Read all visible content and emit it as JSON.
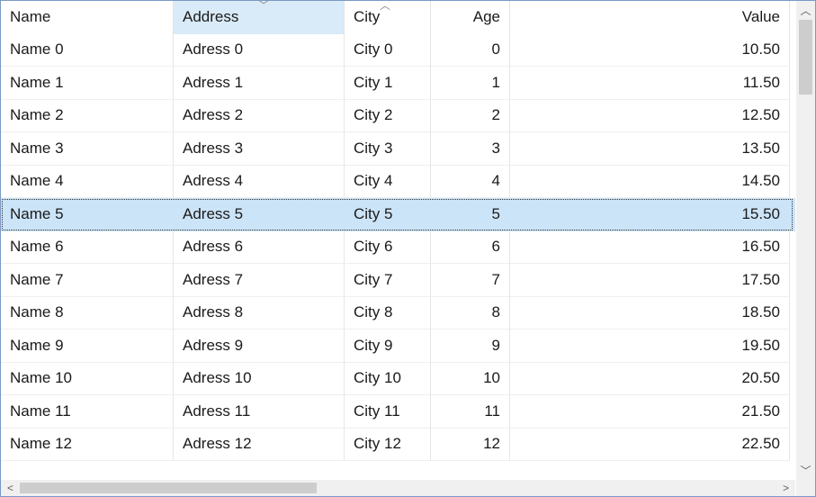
{
  "columns": [
    {
      "label": "Name",
      "align": "left"
    },
    {
      "label": "Address",
      "align": "left",
      "sort_indicator": "chevron-down",
      "highlighted": true
    },
    {
      "label": "City",
      "align": "left",
      "sort_indicator": "chevron-up"
    },
    {
      "label": "Age",
      "align": "right"
    },
    {
      "label": "Value",
      "align": "right"
    }
  ],
  "rows": [
    [
      "Name 0",
      "Adress 0",
      "City 0",
      "0",
      "10.50"
    ],
    [
      "Name 1",
      "Adress 1",
      "City 1",
      "1",
      "11.50"
    ],
    [
      "Name 2",
      "Adress 2",
      "City 2",
      "2",
      "12.50"
    ],
    [
      "Name 3",
      "Adress 3",
      "City 3",
      "3",
      "13.50"
    ],
    [
      "Name 4",
      "Adress 4",
      "City 4",
      "4",
      "14.50"
    ],
    [
      "Name 5",
      "Adress 5",
      "City 5",
      "5",
      "15.50"
    ],
    [
      "Name 6",
      "Adress 6",
      "City 6",
      "6",
      "16.50"
    ],
    [
      "Name 7",
      "Adress 7",
      "City 7",
      "7",
      "17.50"
    ],
    [
      "Name 8",
      "Adress 8",
      "City 8",
      "8",
      "18.50"
    ],
    [
      "Name 9",
      "Adress 9",
      "City 9",
      "9",
      "19.50"
    ],
    [
      "Name 10",
      "Adress 10",
      "City 10",
      "10",
      "20.50"
    ],
    [
      "Name 11",
      "Adress 11",
      "City 11",
      "11",
      "21.50"
    ],
    [
      "Name 12",
      "Adress 12",
      "City 12",
      "12",
      "22.50"
    ]
  ],
  "selected_row": 5,
  "scrollbars": {
    "vertical": {
      "up_icon": "chevron-up-icon",
      "down_icon": "chevron-down-icon",
      "position": 0.0
    },
    "horizontal": {
      "left_icon": "chevron-left-icon",
      "right_icon": "chevron-right-icon",
      "position": 0.0
    }
  },
  "colors": {
    "selection": "#cce4f7",
    "sorted_header": "#d9ebf9",
    "border": "#7a99c6"
  }
}
